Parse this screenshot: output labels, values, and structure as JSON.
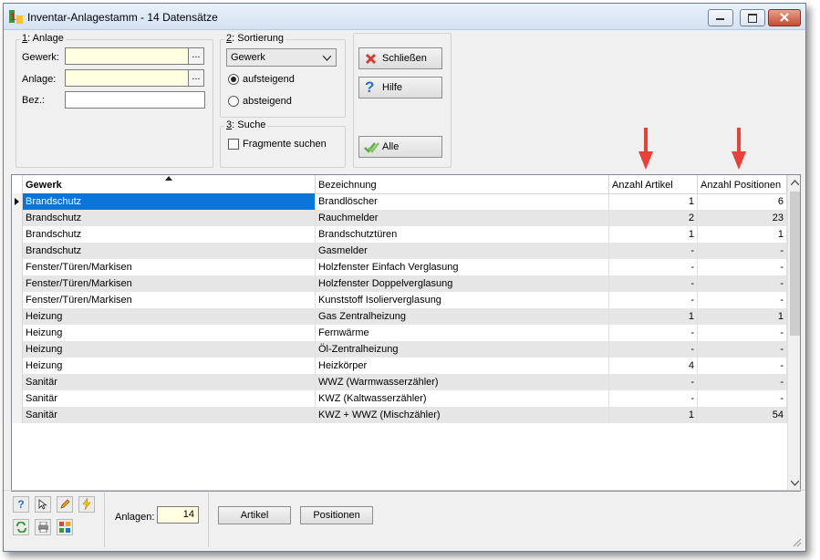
{
  "window": {
    "title": "Inventar-Anlagestamm - 14 Datensätze",
    "icon": "app-number-icon"
  },
  "anlage_group": {
    "title_num": "1",
    "title_text": ": Anlage",
    "gewerk_label": "Gewerk:",
    "gewerk_value": "",
    "anlage_label": "Anlage:",
    "anlage_value": "",
    "bez_label": "Bez.:",
    "bez_value": "",
    "ellipsis": "..."
  },
  "sort_group": {
    "title_num": "2",
    "title_text": ": Sortierung",
    "combo_value": "Gewerk",
    "asc_label": "aufsteigend",
    "desc_label": "absteigend",
    "selected": "aufsteigend"
  },
  "search_group": {
    "title_num": "3",
    "title_text": ": Suche",
    "fragment_label": "Fragmente suchen",
    "fragment_checked": false
  },
  "buttons": {
    "close": "Schließen",
    "help": "Hilfe",
    "all": "Alle"
  },
  "table": {
    "columns": [
      "Gewerk",
      "Bezeichnung",
      "Anzahl Artikel",
      "Anzahl Positionen"
    ],
    "sort_column": "Gewerk",
    "sort_direction": "ascending",
    "rows": [
      [
        "Brandschutz",
        "Brandlöscher",
        "1",
        "6"
      ],
      [
        "Brandschutz",
        "Rauchmelder",
        "2",
        "23"
      ],
      [
        "Brandschutz",
        "Brandschutztüren",
        "1",
        "1"
      ],
      [
        "Brandschutz",
        "Gasmelder",
        "-",
        "-"
      ],
      [
        "Fenster/Türen/Markisen",
        "Holzfenster Einfach Verglasung",
        "-",
        "-"
      ],
      [
        "Fenster/Türen/Markisen",
        "Holzfenster Doppelverglasung",
        "-",
        "-"
      ],
      [
        "Fenster/Türen/Markisen",
        "Kunststoff Isolierverglasung",
        "-",
        "-"
      ],
      [
        "Heizung",
        "Gas Zentralheizung",
        "1",
        "1"
      ],
      [
        "Heizung",
        "Fernwärme",
        "-",
        "-"
      ],
      [
        "Heizung",
        "Öl-Zentralheizung",
        "-",
        "-"
      ],
      [
        "Heizung",
        "Heizkörper",
        "4",
        "-"
      ],
      [
        "Sanitär",
        "WWZ (Warmwasserzähler)",
        "-",
        "-"
      ],
      [
        "Sanitär",
        "KWZ (Kaltwasserzähler)",
        "-",
        "-"
      ],
      [
        "Sanitär",
        "KWZ + WWZ (Mischzähler)",
        "1",
        "54"
      ]
    ],
    "selected_row": 0
  },
  "footer": {
    "anlagen_label": "Anlagen:",
    "anlagen_value": "14",
    "artikel_button": "Artikel",
    "positionen_button": "Positionen",
    "tools": [
      "help-icon",
      "pointer-icon",
      "pencil-icon",
      "lightning-icon",
      "refresh-icon",
      "print-icon",
      "layout-icon"
    ]
  },
  "colors": {
    "selection": "#0a74d9",
    "field_yellow": "#ffffe1",
    "annotation_arrow": "#e8413a",
    "alt_row": "#e6e6e6"
  }
}
